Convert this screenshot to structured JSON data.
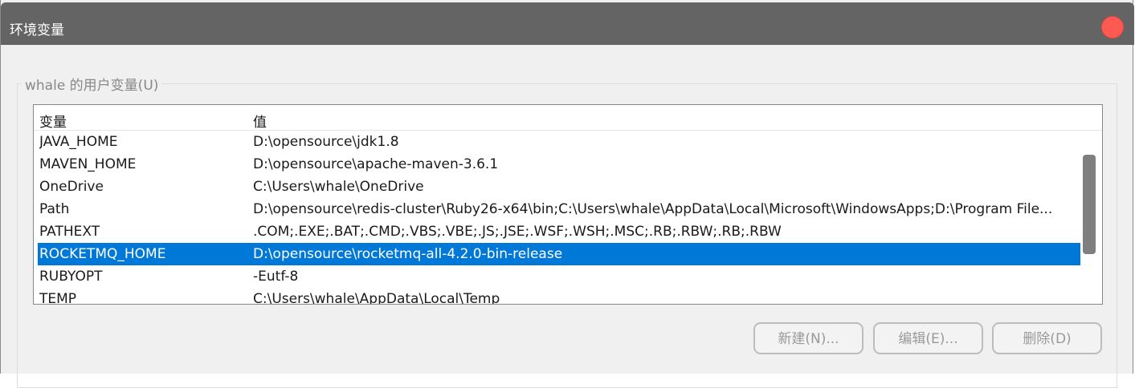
{
  "window": {
    "title": "环境变量"
  },
  "group": {
    "label": "whale 的用户变量(U)"
  },
  "table": {
    "headers": {
      "name": "变量",
      "value": "值"
    },
    "rows": [
      {
        "name": "JAVA_HOME",
        "value": "D:\\opensource\\jdk1.8"
      },
      {
        "name": "MAVEN_HOME",
        "value": "D:\\opensource\\apache-maven-3.6.1"
      },
      {
        "name": "OneDrive",
        "value": "C:\\Users\\whale\\OneDrive"
      },
      {
        "name": "Path",
        "value": "D:\\opensource\\redis-cluster\\Ruby26-x64\\bin;C:\\Users\\whale\\AppData\\Local\\Microsoft\\WindowsApps;D:\\Program File..."
      },
      {
        "name": "PATHEXT",
        "value": ".COM;.EXE;.BAT;.CMD;.VBS;.VBE;.JS;.JSE;.WSF;.WSH;.MSC;.RB;.RBW;.RB;.RBW"
      },
      {
        "name": "ROCKETMQ_HOME",
        "value": "D:\\opensource\\rocketmq-all-4.2.0-bin-release"
      },
      {
        "name": "RUBYOPT",
        "value": "-Eutf-8"
      },
      {
        "name": "TEMP",
        "value": "C:\\Users\\whale\\AppData\\Local\\Temp"
      }
    ],
    "selected_name": "ROCKETMQ_HOME"
  },
  "buttons": {
    "new": "新建(N)...",
    "edit": "编辑(E)...",
    "delete": "删除(D)"
  },
  "colors": {
    "titlebar": "#646464",
    "close": "#ff5a52",
    "selection": "#0078d7",
    "dialog_bg": "#f0f0f0"
  }
}
